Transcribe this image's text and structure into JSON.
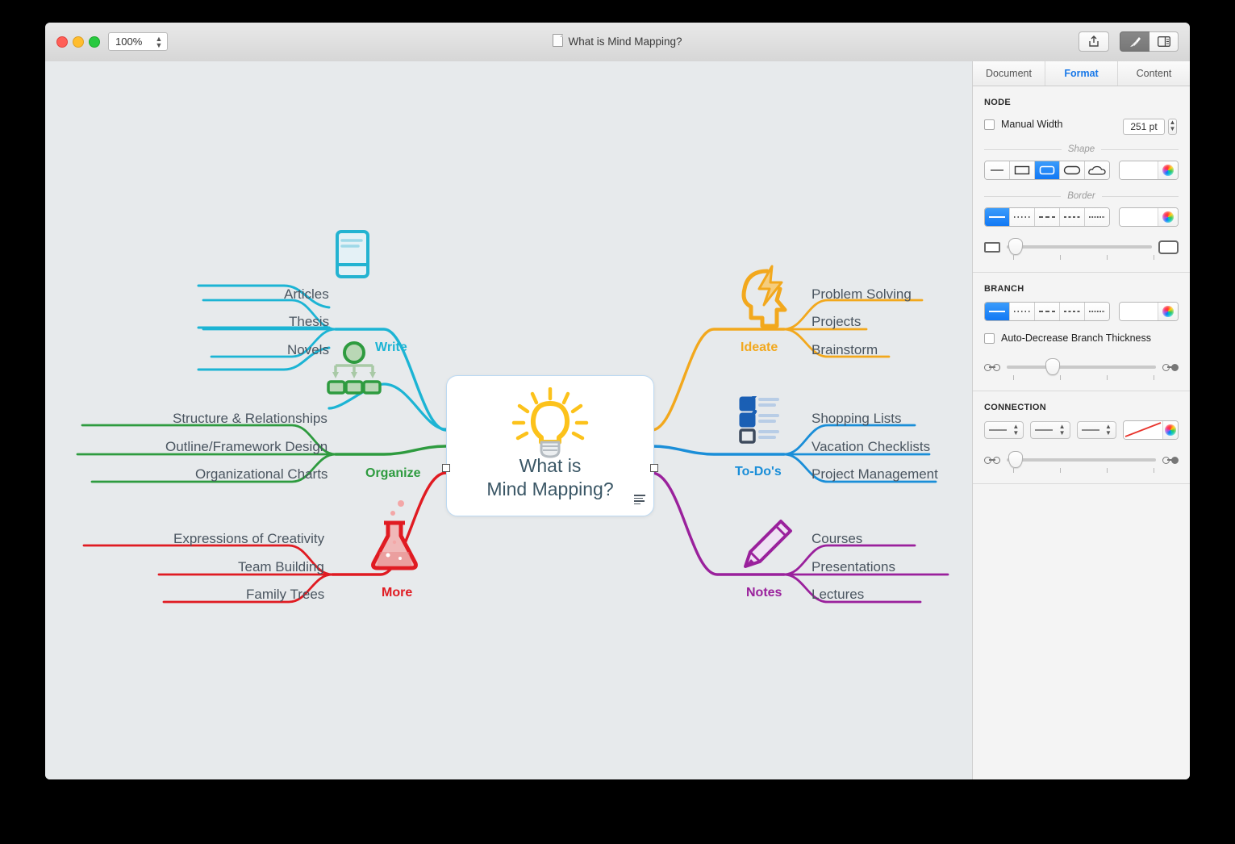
{
  "window": {
    "title": "What is Mind Mapping?",
    "zoom_value": "100%",
    "traffic_lights": [
      "close",
      "minimize",
      "maximize"
    ],
    "toolbar": {
      "share_label": "share-icon",
      "format_label": "format-brush-icon",
      "inspector_label": "inspector-icon"
    }
  },
  "inspector": {
    "tabs": [
      {
        "label": "Document",
        "active": false
      },
      {
        "label": "Format",
        "active": true
      },
      {
        "label": "Content",
        "active": false
      }
    ],
    "node": {
      "section_label": "NODE",
      "manual_width_label": "Manual Width",
      "manual_width_checked": false,
      "width_value": "251 pt",
      "shape_label": "Shape",
      "shape_options": [
        "line",
        "rectangle",
        "rounded-rect",
        "pill",
        "cloud"
      ],
      "shape_selected_index": 2,
      "border_label": "Border",
      "border_styles": [
        "solid",
        "dotted",
        "dashed-long",
        "dashed-medium",
        "dashed-fine"
      ],
      "border_selected_index": 0
    },
    "branch": {
      "section_label": "BRANCH",
      "styles": [
        "solid",
        "dotted",
        "dashed-long",
        "dashed-medium",
        "dashed-fine"
      ],
      "selected_index": 0,
      "auto_decrease_label": "Auto-Decrease Branch Thickness",
      "auto_decrease_checked": false
    },
    "connection": {
      "section_label": "CONNECTION",
      "popups": [
        "line-start",
        "line-style",
        "line-end"
      ]
    }
  },
  "mindmap": {
    "central": {
      "title_line1": "What is",
      "title_line2": "Mind Mapping?",
      "icon": "lightbulb-icon",
      "has_note": true
    },
    "branches": [
      {
        "label": "Write",
        "color": "#1cb4d4",
        "icon": "book-icon",
        "side": "left",
        "children": [
          "Articles",
          "Thesis",
          "Novels"
        ]
      },
      {
        "label": "Organize",
        "color": "#2e9b3f",
        "icon": "hierarchy-icon",
        "side": "left",
        "children": [
          "Structure & Relationships",
          "Outline/Framework Design",
          "Organizational Charts"
        ]
      },
      {
        "label": "More",
        "color": "#e01b22",
        "icon": "flask-icon",
        "side": "left",
        "children": [
          "Expressions of Creativity",
          "Team Building",
          "Family Trees"
        ]
      },
      {
        "label": "Ideate",
        "color": "#f2a81d",
        "icon": "head-lightning-icon",
        "side": "right",
        "children": [
          "Problem Solving",
          "Projects",
          "Brainstorm"
        ]
      },
      {
        "label": "To-Do's",
        "color": "#1a8ed8",
        "icon": "checklist-icon",
        "side": "right",
        "children": [
          "Shopping Lists",
          "Vacation Checklists",
          "Project Management"
        ]
      },
      {
        "label": "Notes",
        "color": "#9a219c",
        "icon": "pencil-icon",
        "side": "right",
        "children": [
          "Courses",
          "Presentations",
          "Lectures"
        ]
      }
    ]
  }
}
